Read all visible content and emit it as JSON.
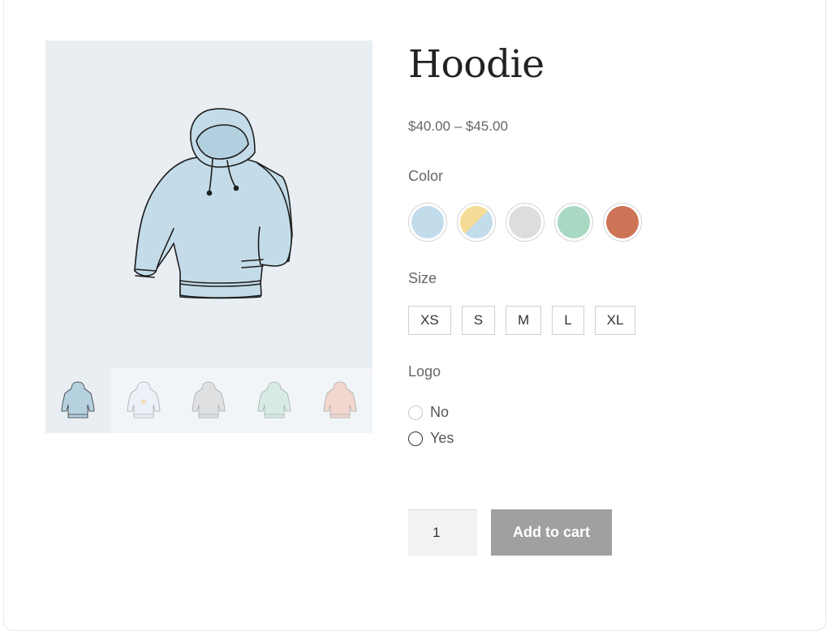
{
  "product": {
    "title": "Hoodie",
    "price": "$40.00 – $45.00"
  },
  "gallery": {
    "main_image": "hoodie-blue",
    "thumbnails": [
      {
        "name": "hoodie-blue",
        "color": "#c5dde9",
        "active": true
      },
      {
        "name": "hoodie-white-logo",
        "color": "#eef3f6",
        "active": false
      },
      {
        "name": "hoodie-grey",
        "color": "#d9d9d9",
        "active": false
      },
      {
        "name": "hoodie-green",
        "color": "#c6e6d6",
        "active": false
      },
      {
        "name": "hoodie-pink",
        "color": "#f1c3b3",
        "active": false
      }
    ]
  },
  "attributes": {
    "color": {
      "label": "Color",
      "swatches": [
        {
          "name": "blue",
          "fill": "#c2dcec"
        },
        {
          "name": "yellow-blue",
          "fill": "#f5dc96",
          "fill2": "#c2dcec"
        },
        {
          "name": "gray",
          "fill": "#dddddd"
        },
        {
          "name": "green",
          "fill": "#a9d8c3"
        },
        {
          "name": "red",
          "fill": "#cd7457"
        }
      ]
    },
    "size": {
      "label": "Size",
      "options": [
        "XS",
        "S",
        "M",
        "L",
        "XL"
      ]
    },
    "logo": {
      "label": "Logo",
      "options": [
        "No",
        "Yes"
      ]
    }
  },
  "cart": {
    "quantity": "1",
    "button_label": "Add to cart"
  },
  "colors": {
    "image_bg": "#e8eef2",
    "button_bg": "#a0a0a0"
  }
}
